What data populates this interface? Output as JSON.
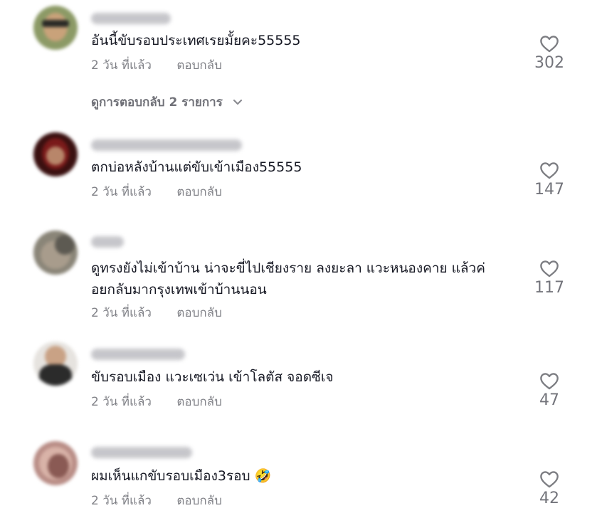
{
  "comments": [
    {
      "text": "อันนี้ขับรอบประเทศเรยมั้ยคะ55555",
      "time": "2 วัน ที่แล้ว",
      "reply_label": "ตอบกลับ",
      "likes": "302",
      "view_replies": "ดูการตอบกลับ 2 รายการ"
    },
    {
      "text": "ตกบ่อหลังบ้านแต่ขับเข้าเมือง55555",
      "time": "2 วัน ที่แล้ว",
      "reply_label": "ตอบกลับ",
      "likes": "147"
    },
    {
      "text_line1": "ดูทรงยังไม่เข้าบ้าน น่าจะขี่ไปเชียงราย ลงยะลา แวะหนองคาย แล้วค่",
      "text_line2": "อยกลับมากรุงเทพเข้าบ้านนอน",
      "time": "2 วัน ที่แล้ว",
      "reply_label": "ตอบกลับ",
      "likes": "117"
    },
    {
      "text": "ขับรอบเมือง แวะเซเว่น เข้าโลตัส จอดซีเจ",
      "time": "2 วัน ที่แล้ว",
      "reply_label": "ตอบกลับ",
      "likes": "47"
    },
    {
      "text": "ผมเห็นแกขับรอบเมือง3รอบ",
      "emoji": "🤣",
      "time": "2 วัน ที่แล้ว",
      "reply_label": "ตอบกลับ",
      "likes": "42"
    }
  ],
  "icons": {
    "like": "heart-outline-icon",
    "expand": "chevron-down-icon"
  },
  "colors": {
    "text": "#161823",
    "muted": "#8a8b91",
    "icon": "#7c7d82"
  }
}
